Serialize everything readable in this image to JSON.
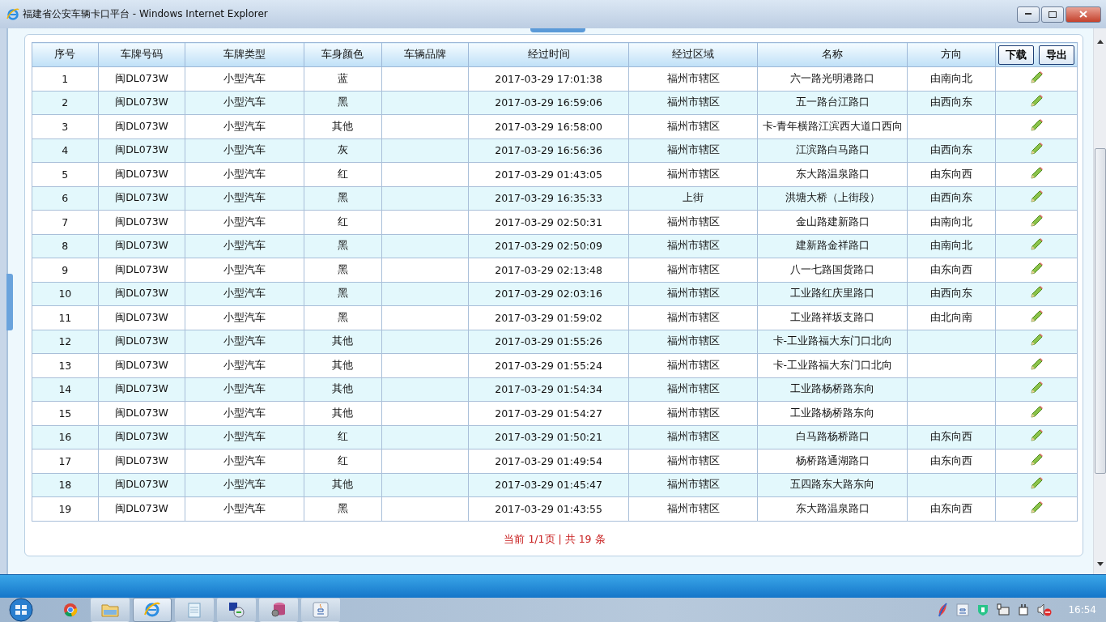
{
  "window": {
    "title": "福建省公安车辆卡口平台 - Windows Internet Explorer"
  },
  "table": {
    "columns": [
      "序号",
      "车牌号码",
      "车牌类型",
      "车身颜色",
      "车辆品牌",
      "经过时间",
      "经过区域",
      "名称",
      "方向"
    ],
    "header_buttons": [
      "下载",
      "导出"
    ],
    "rows": [
      {
        "no": "1",
        "plate": "闽DL073W",
        "type": "小型汽车",
        "body_color": "蓝",
        "time": "2017-03-29 17:01:38",
        "area": "福州市辖区",
        "name": "六一路光明港路口",
        "direction": "由南向北"
      },
      {
        "no": "2",
        "plate": "闽DL073W",
        "type": "小型汽车",
        "body_color": "黑",
        "time": "2017-03-29 16:59:06",
        "area": "福州市辖区",
        "name": "五一路台江路口",
        "direction": "由西向东"
      },
      {
        "no": "3",
        "plate": "闽DL073W",
        "type": "小型汽车",
        "body_color": "其他",
        "time": "2017-03-29 16:58:00",
        "area": "福州市辖区",
        "name": "卡-青年横路江滨西大道口西向"
      },
      {
        "no": "4",
        "plate": "闽DL073W",
        "type": "小型汽车",
        "body_color": "灰",
        "time": "2017-03-29 16:56:36",
        "area": "福州市辖区",
        "name": "江滨路白马路口",
        "direction": "由西向东"
      },
      {
        "no": "5",
        "plate": "闽DL073W",
        "type": "小型汽车",
        "body_color": "红",
        "time": "2017-03-29 01:43:05",
        "area": "福州市辖区",
        "name": "东大路温泉路口",
        "direction": "由东向西"
      },
      {
        "no": "6",
        "plate": "闽DL073W",
        "type": "小型汽车",
        "body_color": "黑",
        "time": "2017-03-29 16:35:33",
        "area": "上街",
        "name": "洪塘大桥（上街段）",
        "direction": "由西向东"
      },
      {
        "no": "7",
        "plate": "闽DL073W",
        "type": "小型汽车",
        "body_color": "红",
        "time": "2017-03-29 02:50:31",
        "area": "福州市辖区",
        "name": "金山路建新路口",
        "direction": "由南向北"
      },
      {
        "no": "8",
        "plate": "闽DL073W",
        "type": "小型汽车",
        "body_color": "黑",
        "time": "2017-03-29 02:50:09",
        "area": "福州市辖区",
        "name": "建新路金祥路口",
        "direction": "由南向北"
      },
      {
        "no": "9",
        "plate": "闽DL073W",
        "type": "小型汽车",
        "body_color": "黑",
        "time": "2017-03-29 02:13:48",
        "area": "福州市辖区",
        "name": "八一七路国货路口",
        "direction": "由东向西"
      },
      {
        "no": "10",
        "plate": "闽DL073W",
        "type": "小型汽车",
        "body_color": "黑",
        "time": "2017-03-29 02:03:16",
        "area": "福州市辖区",
        "name": "工业路红庆里路口",
        "direction": "由西向东"
      },
      {
        "no": "11",
        "plate": "闽DL073W",
        "type": "小型汽车",
        "body_color": "黑",
        "time": "2017-03-29 01:59:02",
        "area": "福州市辖区",
        "name": "工业路祥坂支路口",
        "direction": "由北向南"
      },
      {
        "no": "12",
        "plate": "闽DL073W",
        "type": "小型汽车",
        "body_color": "其他",
        "time": "2017-03-29 01:55:26",
        "area": "福州市辖区",
        "name": "卡-工业路福大东门口北向"
      },
      {
        "no": "13",
        "plate": "闽DL073W",
        "type": "小型汽车",
        "body_color": "其他",
        "time": "2017-03-29 01:55:24",
        "area": "福州市辖区",
        "name": "卡-工业路福大东门口北向"
      },
      {
        "no": "14",
        "plate": "闽DL073W",
        "type": "小型汽车",
        "body_color": "其他",
        "time": "2017-03-29 01:54:34",
        "area": "福州市辖区",
        "name": "工业路杨桥路东向"
      },
      {
        "no": "15",
        "plate": "闽DL073W",
        "type": "小型汽车",
        "body_color": "其他",
        "time": "2017-03-29 01:54:27",
        "area": "福州市辖区",
        "name": "工业路杨桥路东向"
      },
      {
        "no": "16",
        "plate": "闽DL073W",
        "type": "小型汽车",
        "body_color": "红",
        "time": "2017-03-29 01:50:21",
        "area": "福州市辖区",
        "name": "白马路杨桥路口",
        "direction": "由东向西"
      },
      {
        "no": "17",
        "plate": "闽DL073W",
        "type": "小型汽车",
        "body_color": "红",
        "time": "2017-03-29 01:49:54",
        "area": "福州市辖区",
        "name": "杨桥路通湖路口",
        "direction": "由东向西"
      },
      {
        "no": "18",
        "plate": "闽DL073W",
        "type": "小型汽车",
        "body_color": "其他",
        "time": "2017-03-29 01:45:47",
        "area": "福州市辖区",
        "name": "五四路东大路东向"
      },
      {
        "no": "19",
        "plate": "闽DL073W",
        "type": "小型汽车",
        "body_color": "黑",
        "time": "2017-03-29 01:43:55",
        "area": "福州市辖区",
        "name": "东大路温泉路口",
        "direction": "由东向西"
      }
    ]
  },
  "pager": "当前 1/1页 | 共 19 条",
  "taskbar": {
    "apps": [
      {
        "kind": "chrome",
        "selected": false
      },
      {
        "kind": "folder",
        "selected": false
      },
      {
        "kind": "ie",
        "selected": true
      },
      {
        "kind": "notepad",
        "selected": false
      },
      {
        "kind": "remote",
        "selected": false
      },
      {
        "kind": "database",
        "selected": false
      },
      {
        "kind": "java",
        "selected": false
      }
    ],
    "clock": "16:54"
  }
}
